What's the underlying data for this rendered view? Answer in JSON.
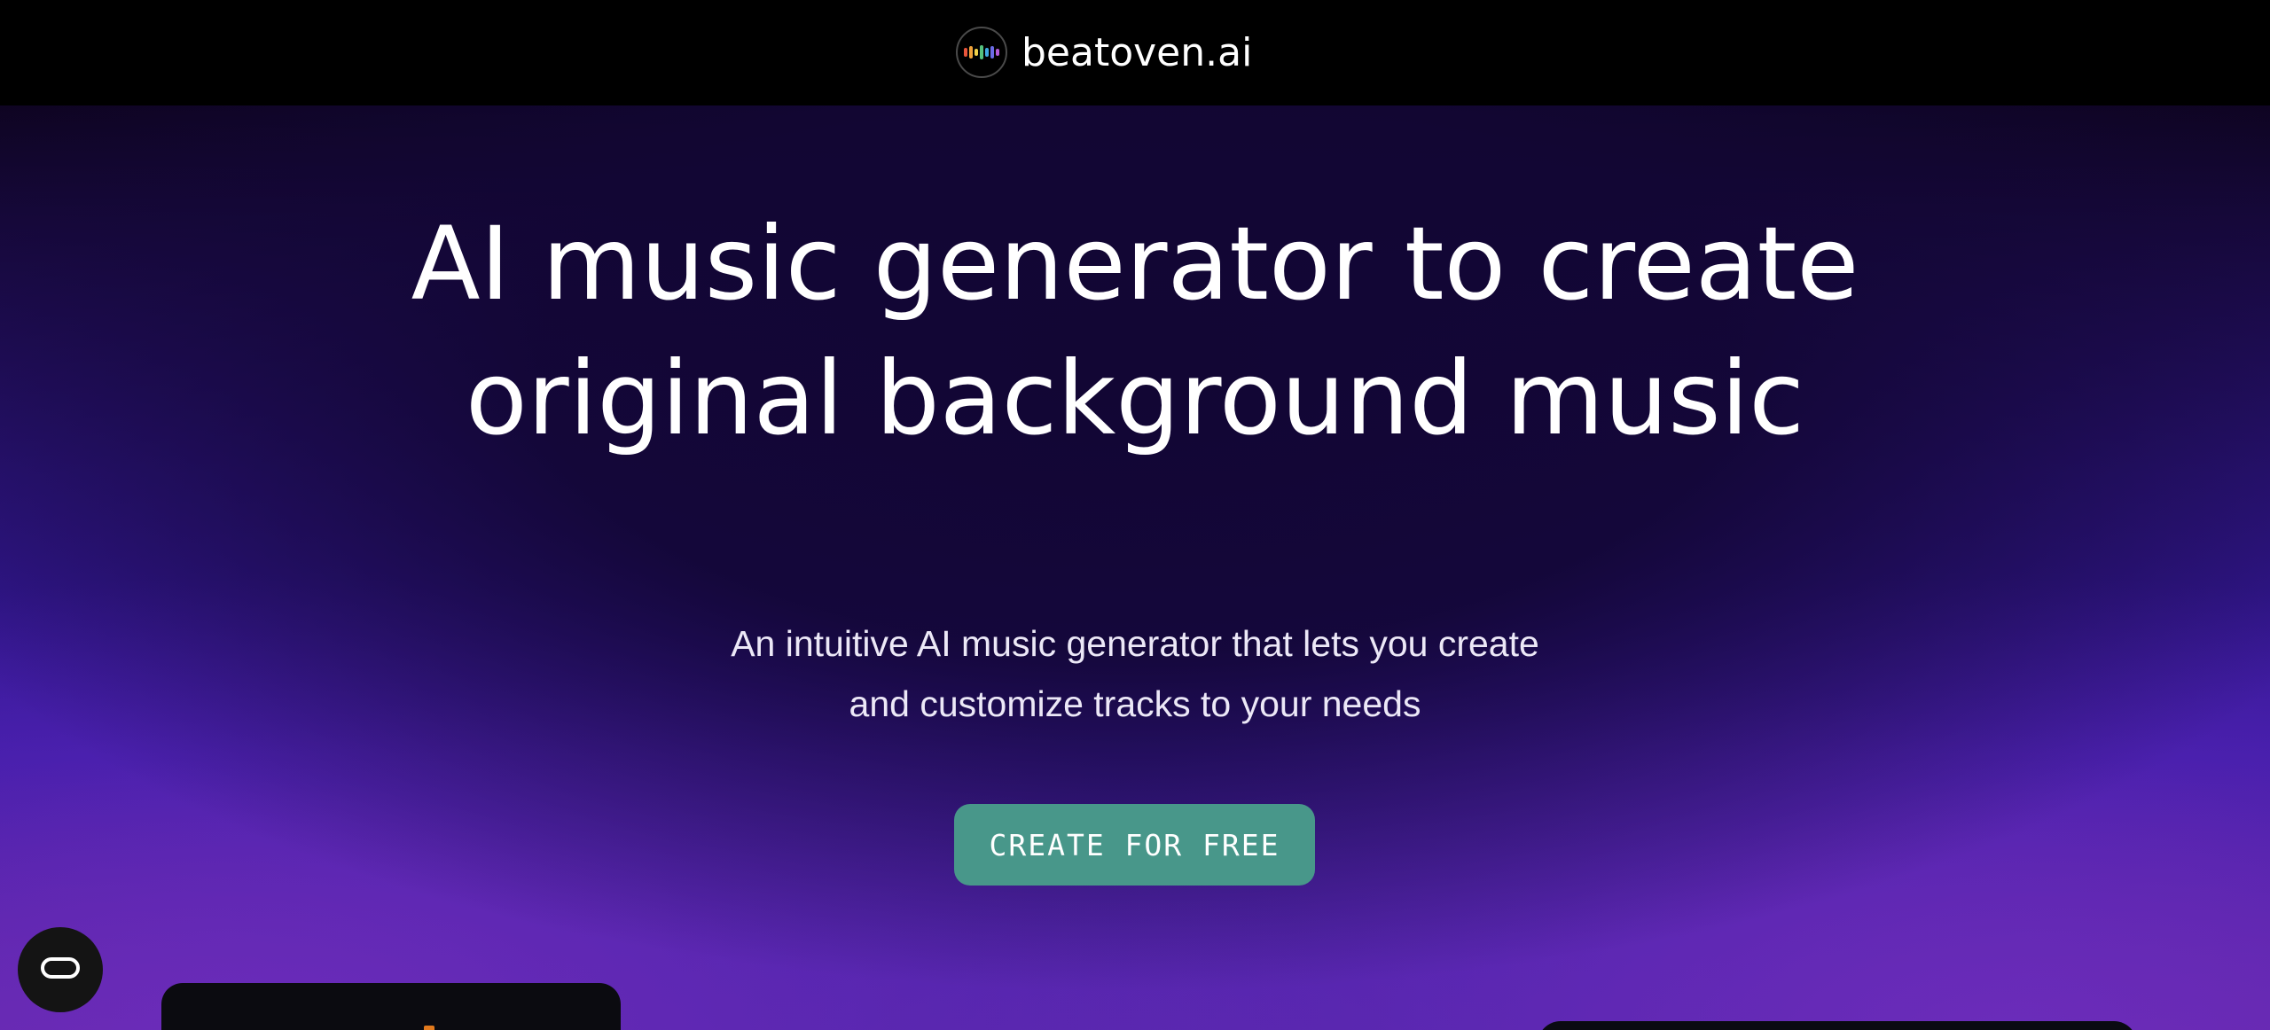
{
  "header": {
    "brand_name": "beatoven.ai",
    "logo_icon": "equalizer-bars-icon"
  },
  "hero": {
    "headline_lines": [
      "AI music generator to create",
      "original background music"
    ],
    "subhead_lines": [
      "An intuitive AI music generator that lets you create",
      "and customize tracks to your needs"
    ],
    "cta_label": "CREATE FOR FREE"
  },
  "floating": {
    "chat_icon": "chat-bubble-icon"
  },
  "colors": {
    "cta_background": "#48978a",
    "topbar_background": "#000000",
    "hero_purple": "#3d1ca8",
    "hero_dark": "#0e0420"
  }
}
